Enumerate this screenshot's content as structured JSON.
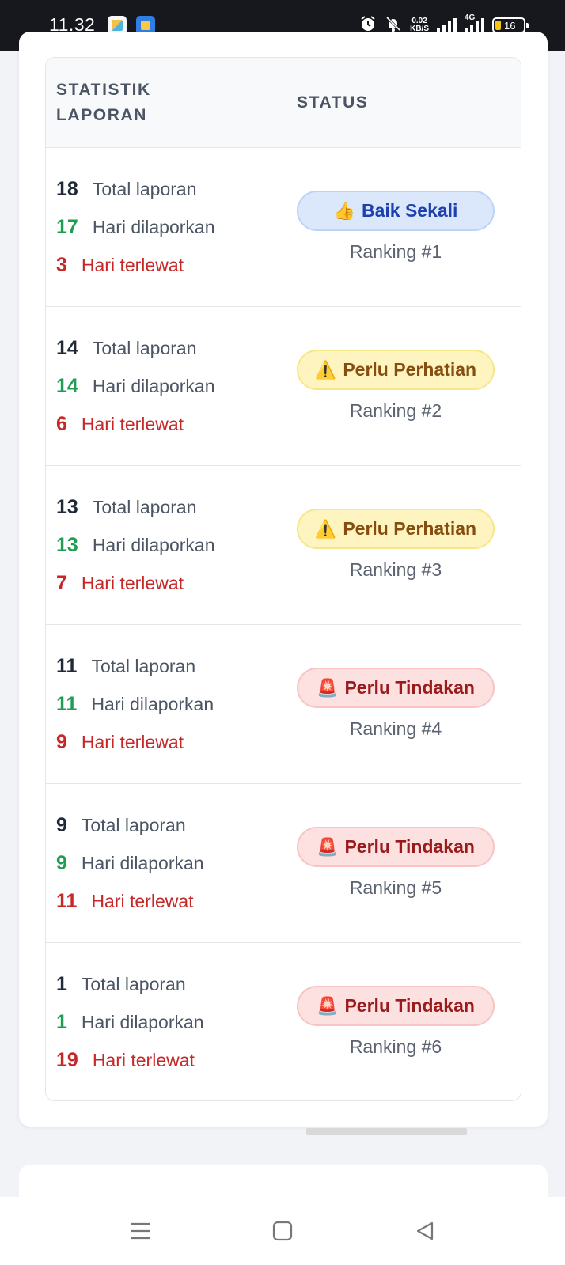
{
  "status_bar": {
    "time": "11.32",
    "net_speed": "0.02",
    "net_unit": "KB/S",
    "network_type": "4G",
    "battery": "16",
    "icons": [
      "alarm-icon",
      "silent-bell-icon",
      "signal-icon",
      "signal-4g-icon",
      "battery-icon"
    ]
  },
  "table": {
    "headers": {
      "stat": "STATISTIK LAPORAN",
      "status": "STATUS"
    },
    "labels": {
      "total": "Total laporan",
      "reported": "Hari dilaporkan",
      "missed": "Hari terlewat"
    },
    "rows": [
      {
        "total": "18",
        "reported": "17",
        "missed": "3",
        "emoji": "👍",
        "status": "Baik Sekali",
        "level": "good",
        "rank": "Ranking #1"
      },
      {
        "total": "14",
        "reported": "14",
        "missed": "6",
        "emoji": "⚠️",
        "status": "Perlu Perhatian",
        "level": "warn",
        "rank": "Ranking #2"
      },
      {
        "total": "13",
        "reported": "13",
        "missed": "7",
        "emoji": "⚠️",
        "status": "Perlu Perhatian",
        "level": "warn",
        "rank": "Ranking #3"
      },
      {
        "total": "11",
        "reported": "11",
        "missed": "9",
        "emoji": "🚨",
        "status": "Perlu Tindakan",
        "level": "crit",
        "rank": "Ranking #4"
      },
      {
        "total": "9",
        "reported": "9",
        "missed": "11",
        "emoji": "🚨",
        "status": "Perlu Tindakan",
        "level": "crit",
        "rank": "Ranking #5"
      },
      {
        "total": "1",
        "reported": "1",
        "missed": "19",
        "emoji": "🚨",
        "status": "Perlu Tindakan",
        "level": "crit",
        "rank": "Ranking #6"
      }
    ]
  },
  "colors": {
    "good": "#dbe8fb",
    "warn": "#fdf4bf",
    "crit": "#fde0e0",
    "reported_green": "#1f9d55",
    "missed_red": "#c62828"
  },
  "navbar": {
    "buttons": [
      "menu-icon",
      "home-square-icon",
      "back-triangle-icon"
    ]
  }
}
